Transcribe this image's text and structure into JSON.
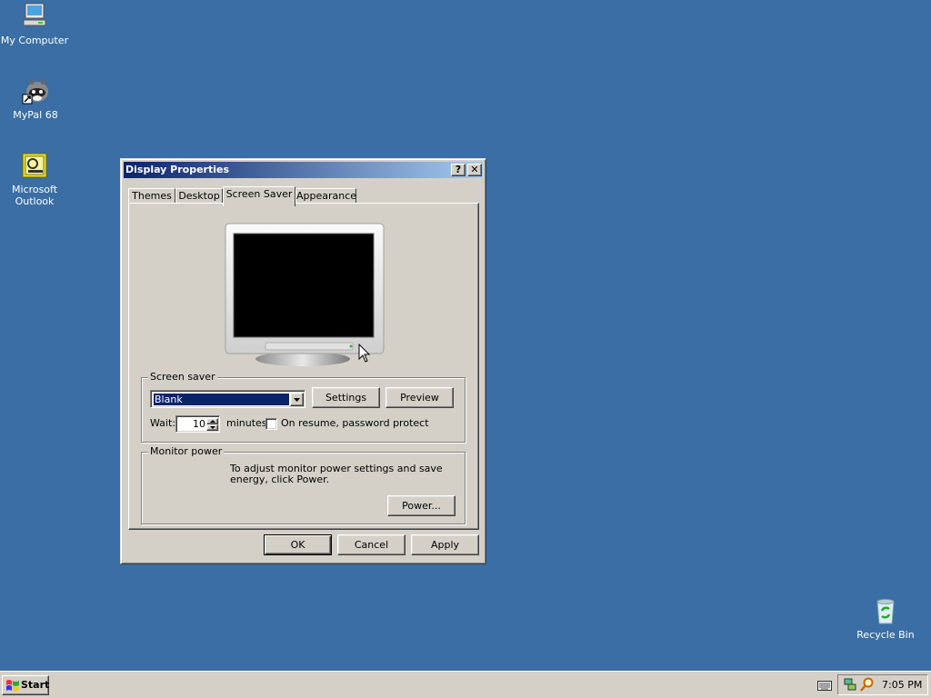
{
  "desktop": {
    "icons": [
      {
        "label": "My Computer",
        "icon": "my-computer-icon"
      },
      {
        "label": "MyPal 68",
        "icon": "raccoon-browser-icon"
      },
      {
        "label": "Microsoft Outlook",
        "icon": "outlook-icon"
      },
      {
        "label": "Recycle Bin",
        "icon": "recycle-bin-icon"
      }
    ],
    "background_color": "#3a6ea5"
  },
  "dialog": {
    "title": "Display Properties",
    "help_label": "?",
    "close_label": "✕",
    "tabs": [
      {
        "label": "Themes"
      },
      {
        "label": "Desktop"
      },
      {
        "label": "Screen Saver",
        "active": true
      },
      {
        "label": "Appearance"
      }
    ],
    "screen_saver": {
      "group_title": "Screen saver",
      "selected": "Blank",
      "settings_label": "Settings",
      "preview_label": "Preview",
      "wait_label": "Wait:",
      "wait_value": "10",
      "minutes_label": "minutes",
      "password_label": "On resume, password protect",
      "password_checked": false
    },
    "monitor_power": {
      "group_title": "Monitor power",
      "description": "To adjust monitor power settings and save energy, click Power.",
      "power_label": "Power..."
    },
    "ok_label": "OK",
    "cancel_label": "Cancel",
    "apply_label": "Apply"
  },
  "taskbar": {
    "start_label": "Start",
    "clock": "7:05 PM",
    "tray_icons": [
      "keyboard-icon",
      "network-icon",
      "search-icon"
    ]
  },
  "colors": {
    "titlebar_start": "#0a246a",
    "titlebar_end": "#a6caf0",
    "selection": "#0a246a",
    "window_face": "#d4d0c8"
  }
}
